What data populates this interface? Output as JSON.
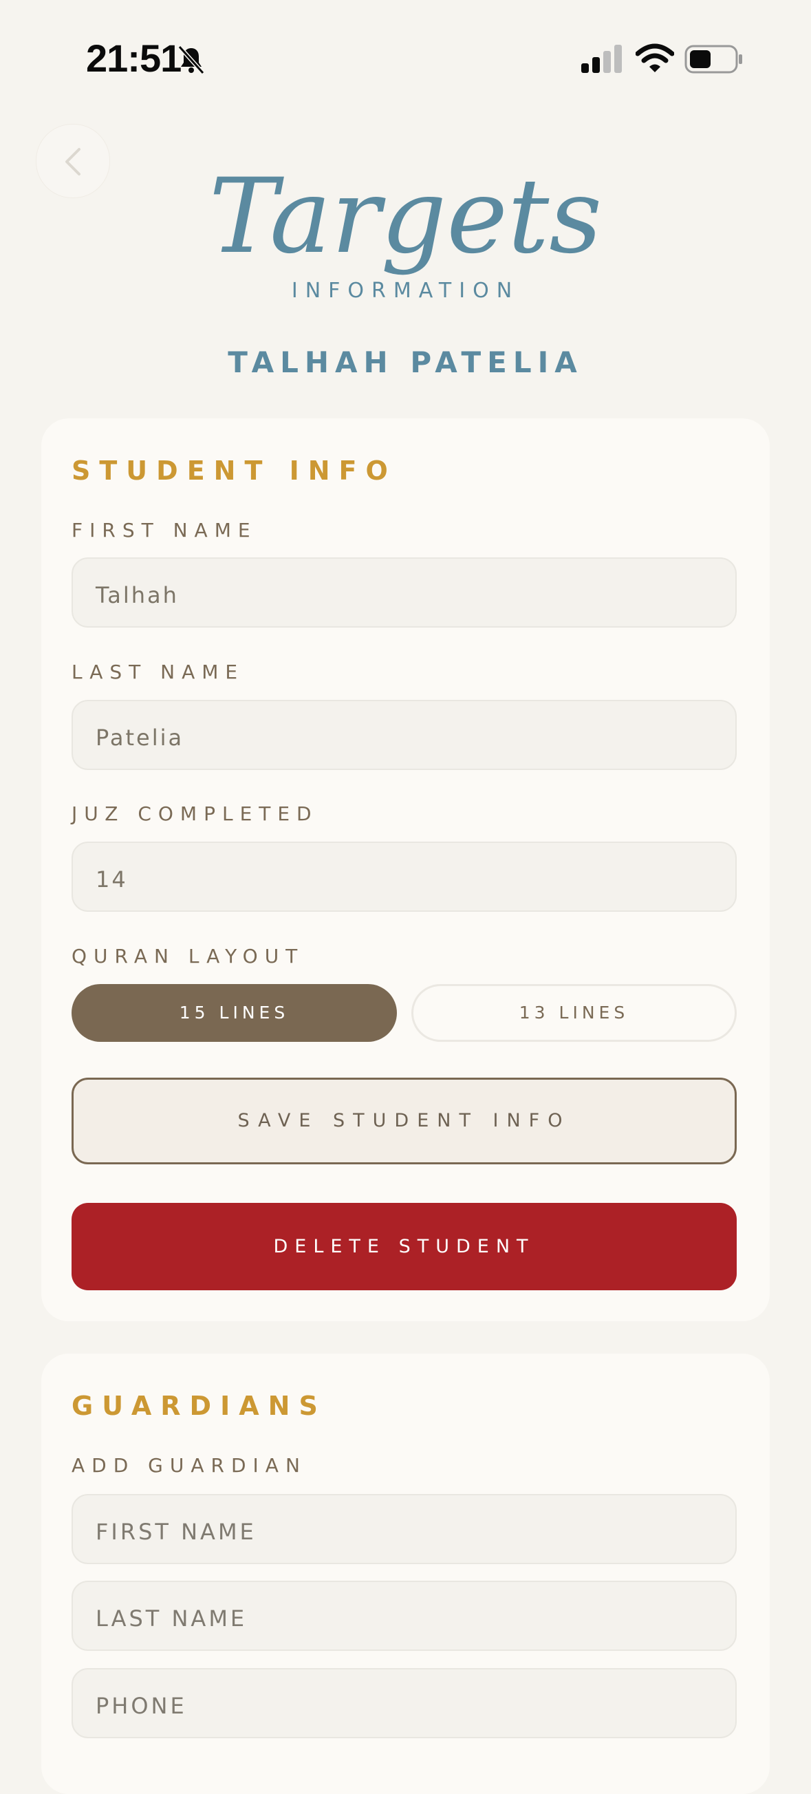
{
  "status_bar": {
    "time": "21:51",
    "icons": [
      "bell-slash-icon",
      "cellular-signal-icon",
      "wifi-icon",
      "battery-icon"
    ]
  },
  "header": {
    "back_icon": "chevron-left-icon",
    "logo_text": "Targets",
    "logo_subtitle": "INFORMATION",
    "student_name": "TALHAH PATELIA"
  },
  "student_info": {
    "title": "STUDENT INFO",
    "first_name_label": "FIRST NAME",
    "first_name_value": "Talhah",
    "last_name_label": "LAST NAME",
    "last_name_value": "Patelia",
    "juz_label": "JUZ COMPLETED",
    "juz_value": "14",
    "layout_label": "QURAN LAYOUT",
    "layout_options": [
      "15 LINES",
      "13 LINES"
    ],
    "layout_selected": "15 LINES",
    "save_label": "SAVE STUDENT INFO",
    "delete_label": "DELETE STUDENT"
  },
  "guardians": {
    "title": "GUARDIANS",
    "add_label": "ADD GUARDIAN",
    "first_name_placeholder": "FIRST NAME",
    "last_name_placeholder": "LAST NAME",
    "phone_placeholder": "PHONE"
  },
  "colors": {
    "accent_blue": "#5b8aa0",
    "section_gold": "#cc9833",
    "selected_brown": "#7a6852",
    "danger_red": "#ac2126",
    "background": "#f6f4ef"
  }
}
